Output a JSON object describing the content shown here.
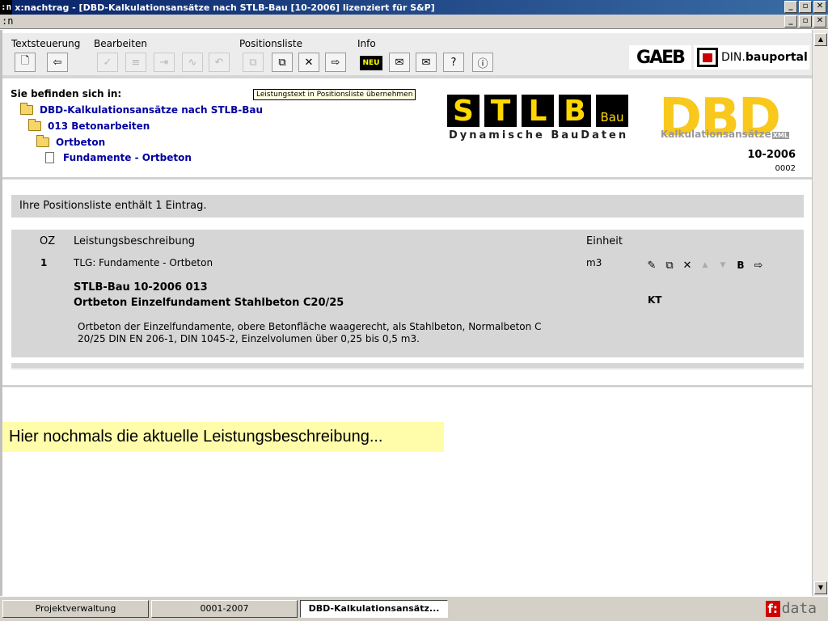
{
  "window": {
    "app_badge": ":n",
    "title": "x:nachtrag - [DBD-Kalkulationsansätze nach STLB-Bau [10-2006] lizenziert für S&P]",
    "mdi_badge": ":n",
    "min_label": "_",
    "restore_label": "▫",
    "close_label": "✕"
  },
  "toolbar": {
    "menus": [
      "Textsteuerung",
      "Bearbeiten",
      "Positionsliste",
      "Info"
    ],
    "neu_label": "NEU",
    "logos": {
      "gaeb": "GAEB",
      "din_prefix": "DIN",
      "din_suffix": "bauportal"
    }
  },
  "tooltip": "Leistungstext in Positionsliste übernehmen",
  "breadcrumb": {
    "heading": "Sie befinden sich in:",
    "items": [
      "DBD-Kalkulationsansätze nach STLB-Bau",
      "013 Betonarbeiten",
      "Ortbeton",
      "Fundamente - Ortbeton"
    ]
  },
  "logo": {
    "stlb_letters": [
      "S",
      "T",
      "L",
      "B"
    ],
    "stlb_bau": "Bau",
    "stlb_sub": "Dynamische BauDaten",
    "dbd": "DBD",
    "dbd_sub": "Kalkulationsansätze",
    "dbd_xml": "XML",
    "version": "10-2006",
    "version_sub": "0002"
  },
  "position_list": {
    "summary": "Ihre Positionsliste enthält 1 Eintrag.",
    "headers": {
      "oz": "OZ",
      "description": "Leistungsbeschreibung",
      "unit": "Einheit"
    },
    "rows": [
      {
        "oz": "1",
        "tlg": "TLG: Fundamente - Ortbeton",
        "unit": "m3",
        "code": "STLB-Bau 10-2006 013",
        "short_text": "Ortbeton Einzelfundament Stahlbeton C20/25",
        "long_text_1": "Ortbeton der Einzelfundamente, obere Betonfläche waagerecht, als Stahlbeton, Normalbeton C",
        "long_text_2": "20/25 DIN EN 206-1, DIN 1045-2, Einzelvolumen über 0,25 bis 0,5 m3.",
        "b_label": "B",
        "kt_label": "KT"
      }
    ]
  },
  "banner": "Hier nochmals die aktuelle Leistungsbeschreibung...",
  "taskbar": {
    "items": [
      "Projektverwaltung",
      "0001-2007",
      "DBD-Kalkulationsansätz..."
    ],
    "brand_f": "f:",
    "brand_text": "data"
  },
  "colors": {
    "title_bar": "#0a246a",
    "link": "#0000a0",
    "stlb_yellow": "#ffd800",
    "dbd_yellow": "#f8c81c",
    "banner": "#fffcaa",
    "brand_red": "#d00000"
  }
}
